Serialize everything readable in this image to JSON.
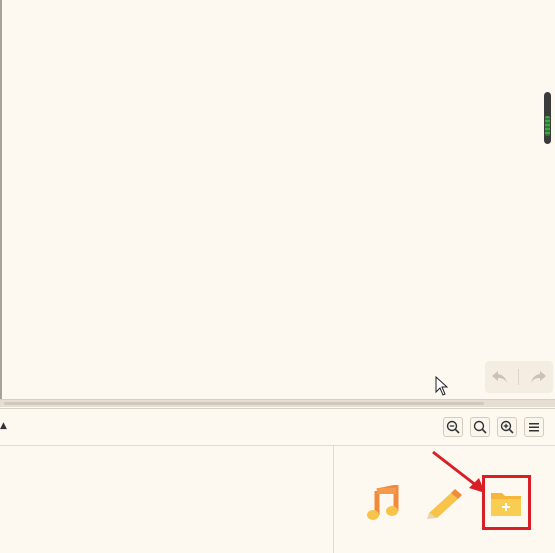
{
  "colors": {
    "background": "#fdf9f1",
    "annotation_red": "#d81f26",
    "folder_yellow": "#f7c34a",
    "music_orange": "#f08a3c"
  },
  "canvas": {
    "undo_icon": "undo-icon",
    "redo_icon": "redo-icon"
  },
  "toolbar": {
    "collapse_icon": "caret-up-icon",
    "zoom_out_icon": "zoom-out-icon",
    "zoom_reset_icon": "zoom-reset-icon",
    "zoom_in_icon": "zoom-in-icon",
    "menu_icon": "hamburger-menu-icon"
  },
  "tools": [
    {
      "icon": "music-icon"
    },
    {
      "icon": "pencil-icon"
    },
    {
      "icon": "new-folder-icon"
    }
  ]
}
